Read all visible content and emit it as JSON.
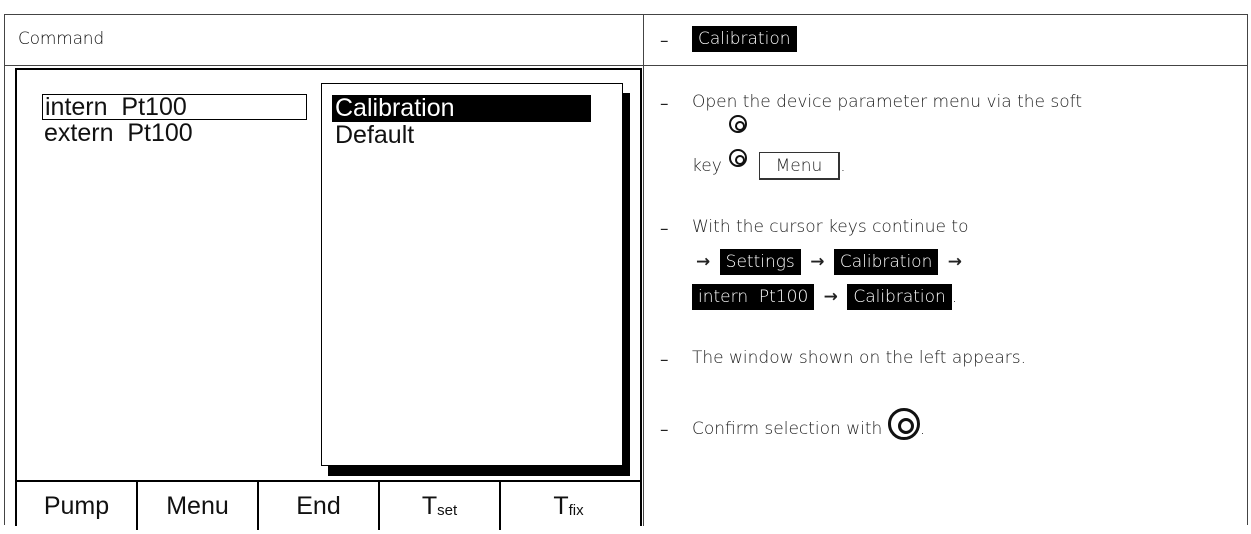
{
  "command_column": {
    "header": "Command"
  },
  "device_screen": {
    "list_items": [
      "intern  Pt100",
      "extern  Pt100"
    ],
    "popup_items": [
      "Calibration",
      "Default"
    ],
    "softkeys": [
      {
        "label": "Pump"
      },
      {
        "label": "Menu"
      },
      {
        "label": "End"
      },
      {
        "label": "T",
        "sub": "set"
      },
      {
        "label": "T",
        "sub": "fix"
      }
    ]
  },
  "instructions": {
    "title_highlight": "Calibration",
    "step1_text": "Open the device parameter menu via the soft",
    "step1_key_prefix": "key",
    "step1_menu_label": "Menu",
    "step2_text": "With the cursor keys continue to",
    "step2_path": [
      "Settings",
      "Calibration",
      "intern  Pt100",
      "Calibration"
    ],
    "step3_text": "The window shown on the left appears.",
    "step4_text": "Confirm selection with",
    "dash": "–",
    "arrow": "→",
    "period": "."
  },
  "icons": {
    "knob_small": "rotary-knob-icon",
    "knob_large": "rotary-knob-icon"
  }
}
